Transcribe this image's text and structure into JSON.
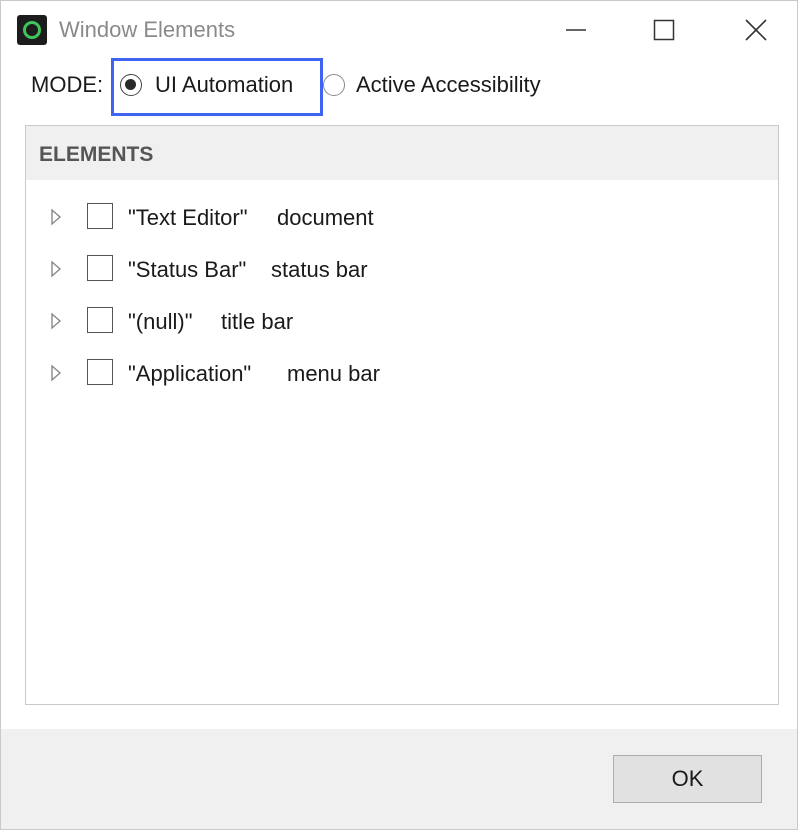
{
  "window": {
    "title": "Window Elements",
    "icon": "app-logo-icon",
    "controls": [
      "minimize-icon",
      "maximize-icon",
      "close-icon"
    ]
  },
  "mode": {
    "label": "MODE:",
    "options": [
      {
        "label": "UI Automation",
        "selected": true
      },
      {
        "label": "Active Accessibility",
        "selected": false
      }
    ]
  },
  "elements": {
    "header": "ELEMENTS",
    "rows": [
      {
        "name": "\"Text Editor\"",
        "type": "document",
        "checked": false
      },
      {
        "name": "\"Status Bar\"",
        "type": "status bar",
        "checked": false
      },
      {
        "name": "\"(null)\"",
        "type": "title bar",
        "checked": false
      },
      {
        "name": "\"Application\"",
        "type": "menu bar",
        "checked": false
      }
    ]
  },
  "footer": {
    "ok_label": "OK"
  },
  "colors": {
    "highlight_border": "#3f63f2",
    "app_icon_accent": "#3ec45a"
  }
}
